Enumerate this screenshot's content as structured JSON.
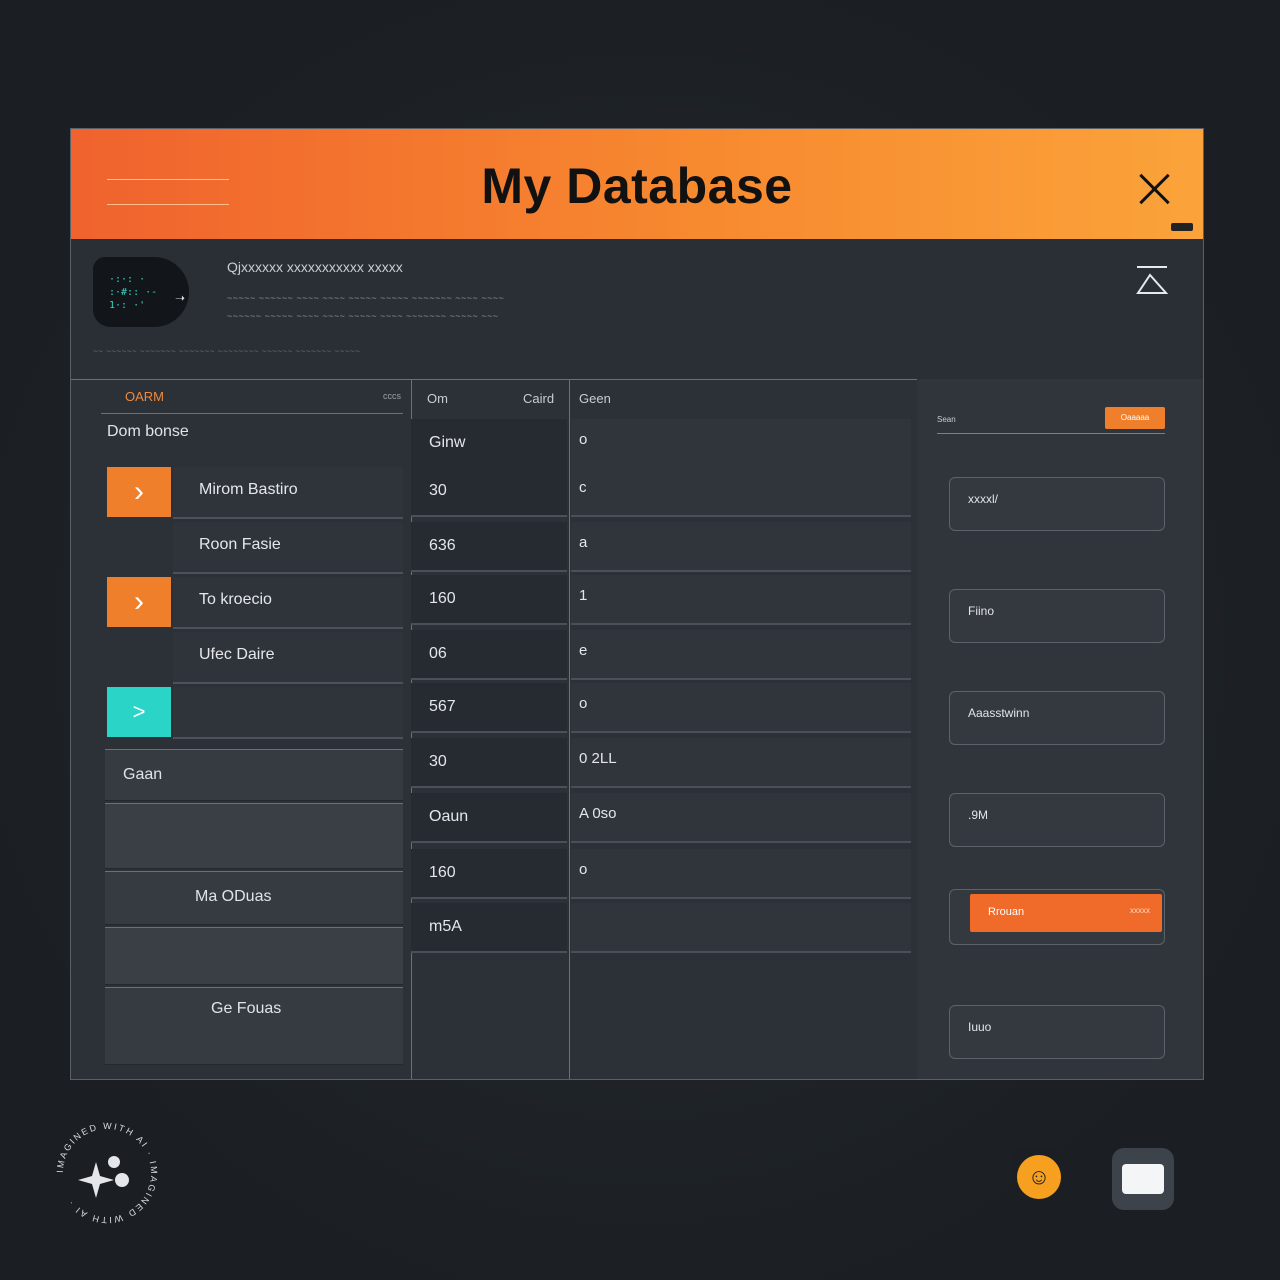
{
  "window": {
    "title": "My Database",
    "close_icon": "close-icon"
  },
  "info": {
    "badge_text": "·:·: ·\n:·#:: ·-\n1·: ·'",
    "heading": "Qjxxxxxx xxxxxxxxxxx xxxxx",
    "line1": "~~~~~ ~~~~~~ ~~~~ ~~~~ ~~~~~ ~~~~~ ~~~~~~~ ~~~~ ~~~~",
    "line2": "~~~~~~ ~~~~~ ~~~~ ~~~~  ~~~~~ ~~~~ ~~~~~~~ ~~~~~ ~~~",
    "footer": "~~ ~~~~~~ ~~~~~~~ ~~~~~~~ ~~~~~~~~ ~~~~~~ ~~~~~~~ ~~~~~"
  },
  "sidebar": {
    "section_label": "OARM",
    "section_right": "cccs",
    "title": "Dom bonse",
    "items": [
      {
        "label": "Mirom Bastiro",
        "button_icon": "chevron-right-icon"
      },
      {
        "label": "Roon Fasie"
      },
      {
        "label": "To kroecio",
        "button_icon": "chevron-right-icon"
      },
      {
        "label": "Ufec Daire"
      },
      {
        "label": "",
        "button_icon": "play-arrow-icon"
      }
    ],
    "cards": [
      {
        "label": "Gaan"
      },
      {
        "label": ""
      },
      {
        "label": "Ma ODuas"
      },
      {
        "label": ""
      },
      {
        "label": "Ge Fouas"
      }
    ]
  },
  "table": {
    "headers": [
      "Om",
      "Caird",
      "Geen"
    ],
    "rows": [
      {
        "c1": "Ginw",
        "c2": "o"
      },
      {
        "c1": "30",
        "c2": "c"
      },
      {
        "c1": "636",
        "c2": "a"
      },
      {
        "c1": "160",
        "c2": "1"
      },
      {
        "c1": "06",
        "c2": "e"
      },
      {
        "c1": "567",
        "c2": "o"
      },
      {
        "c1": "30",
        "c2": "0 2LL"
      },
      {
        "c1": "Oaun",
        "c2": "A 0so"
      },
      {
        "c1": "160",
        "c2": "o"
      },
      {
        "c1": "m5A",
        "c2": ""
      }
    ]
  },
  "panel": {
    "search_label": "Sean",
    "search_button": "Oaaaaa",
    "fields": [
      {
        "label": "xxxxl/"
      },
      {
        "label": "Fiino"
      },
      {
        "label": "Aaasstwinn"
      },
      {
        "label": ".9M"
      },
      {
        "label": "Rrouan",
        "accent": true,
        "extra": "xxxxx"
      },
      {
        "label": "Iuuo"
      }
    ]
  },
  "watermark": {
    "text": "IMAGINED WITH AI · IMAGINED WITH AI ·"
  },
  "dock": [
    {
      "icon": "orange-app-icon"
    },
    {
      "icon": "white-app-icon"
    }
  ],
  "colors": {
    "accent_orange": "#f07f2c",
    "accent_teal": "#2ad4c6",
    "title_gradient_start": "#f0622e",
    "title_gradient_end": "#fba33a",
    "background": "#1e2227"
  }
}
